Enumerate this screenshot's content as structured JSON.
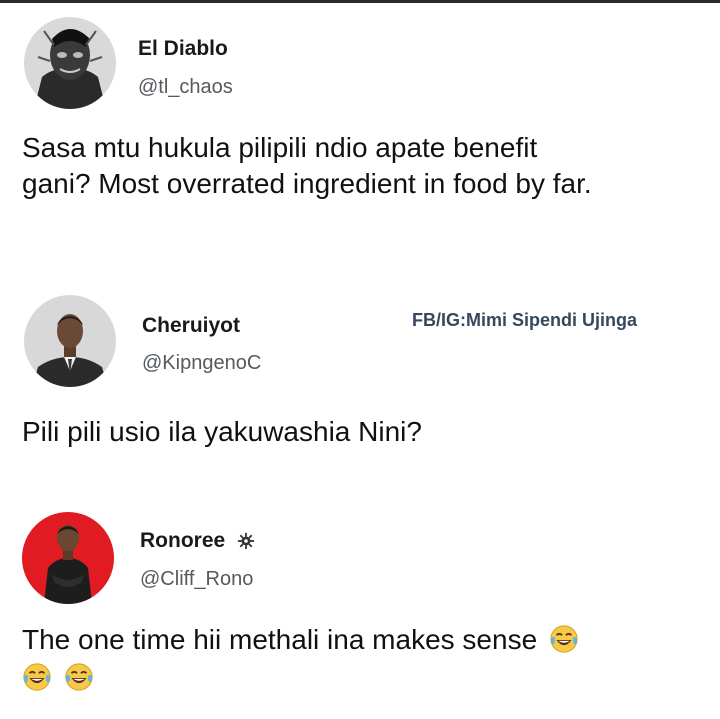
{
  "tweets": [
    {
      "name": "El Diablo",
      "handle": "@tl_chaos",
      "text_line1": "Sasa mtu hukula pilipili ndio apate benefit",
      "text_line2": "gani? Most overrated ingredient in food by far.",
      "avatar_icon": "sketch-portrait-avatar"
    },
    {
      "name": "Cheruiyot",
      "handle": "@KipngenoC",
      "text": "Pili pili usio ila yakuwashia Nini?",
      "avatar_icon": "man-in-suit-avatar"
    },
    {
      "name": "Ronoree",
      "handle": "@Cliff_Rono",
      "text": "The one time hii methali ina makes sense",
      "avatar_icon": "man-red-background-avatar",
      "badge_icon": "gear-badge-icon",
      "emoji_icon": "laughing-tears-emoji"
    }
  ],
  "watermark": "FB/IG:Mimi Sipendi Ujinga",
  "colors": {
    "name": "#1a1a1a",
    "handle": "#555a5f",
    "watermark": "#34495e",
    "avatar3_bg": "#e01b22"
  }
}
